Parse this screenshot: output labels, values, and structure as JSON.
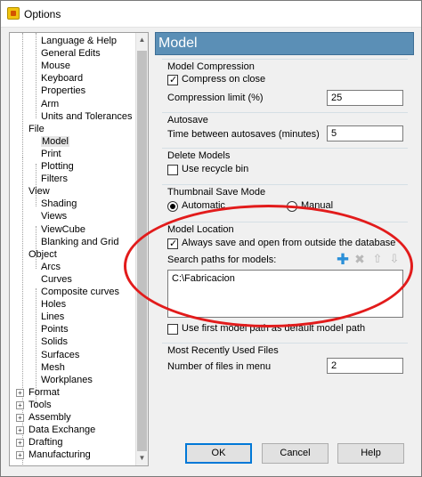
{
  "window": {
    "title": "Options",
    "icon": "app-icon"
  },
  "tree": {
    "nodes": [
      {
        "label": "Language & Help",
        "level": 1
      },
      {
        "label": "General Edits",
        "level": 1
      },
      {
        "label": "Mouse",
        "level": 1
      },
      {
        "label": "Keyboard",
        "level": 1
      },
      {
        "label": "Properties",
        "level": 1
      },
      {
        "label": "Arm",
        "level": 1
      },
      {
        "label": "Units and Tolerances",
        "level": 1
      },
      {
        "label": "File",
        "level": 0,
        "expanded": true
      },
      {
        "label": "Model",
        "level": 1,
        "selected": true
      },
      {
        "label": "Print",
        "level": 1
      },
      {
        "label": "Plotting",
        "level": 1
      },
      {
        "label": "Filters",
        "level": 1
      },
      {
        "label": "View",
        "level": 0,
        "expanded": true
      },
      {
        "label": "Shading",
        "level": 1
      },
      {
        "label": "Views",
        "level": 1
      },
      {
        "label": "ViewCube",
        "level": 1
      },
      {
        "label": "Blanking and Grid",
        "level": 1
      },
      {
        "label": "Object",
        "level": 0,
        "expanded": true
      },
      {
        "label": "Arcs",
        "level": 1
      },
      {
        "label": "Curves",
        "level": 1
      },
      {
        "label": "Composite curves",
        "level": 1
      },
      {
        "label": "Holes",
        "level": 1
      },
      {
        "label": "Lines",
        "level": 1
      },
      {
        "label": "Points",
        "level": 1
      },
      {
        "label": "Solids",
        "level": 1
      },
      {
        "label": "Surfaces",
        "level": 1
      },
      {
        "label": "Mesh",
        "level": 1
      },
      {
        "label": "Workplanes",
        "level": 1
      },
      {
        "label": "Format",
        "level": 0,
        "expanded": false
      },
      {
        "label": "Tools",
        "level": 0,
        "expanded": false
      },
      {
        "label": "Assembly",
        "level": 0,
        "expanded": false
      },
      {
        "label": "Data Exchange",
        "level": 0,
        "expanded": false
      },
      {
        "label": "Drafting",
        "level": 0,
        "expanded": false
      },
      {
        "label": "Manufacturing",
        "level": 0,
        "expanded": false
      }
    ]
  },
  "panel": {
    "header": "Model",
    "model_compression": {
      "title": "Model Compression",
      "compress_on_close": {
        "label": "Compress on close",
        "checked": true
      },
      "limit_label": "Compression limit (%)",
      "limit_value": "25"
    },
    "autosave": {
      "title": "Autosave",
      "time_label": "Time between autosaves (minutes)",
      "time_value": "5"
    },
    "delete_models": {
      "title": "Delete Models",
      "recycle_bin": {
        "label": "Use recycle bin",
        "checked": false
      }
    },
    "thumbnail": {
      "title": "Thumbnail Save Mode",
      "automatic": {
        "label": "Automatic",
        "checked": true
      },
      "manual": {
        "label": "Manual",
        "checked": false
      }
    },
    "model_location": {
      "title": "Model Location",
      "always_save": {
        "label": "Always save and open from outside the database",
        "checked": true
      },
      "search_label": "Search paths for models:",
      "paths": [
        "C:\\Fabricacion"
      ],
      "first_path_default": {
        "label": "Use first model path as default model path",
        "checked": false
      }
    },
    "recent_files": {
      "title": "Most Recently Used Files",
      "count_label": "Number of files in menu",
      "count_value": "2"
    },
    "buttons": {
      "ok": "OK",
      "cancel": "Cancel",
      "help": "Help"
    }
  },
  "colors": {
    "header_bg": "#5b8fb6",
    "annotation": "#e21b1b",
    "add_icon": "#2a8fd8"
  },
  "icons": [
    "add-path-icon",
    "delete-path-icon",
    "move-up-icon",
    "move-down-icon"
  ]
}
